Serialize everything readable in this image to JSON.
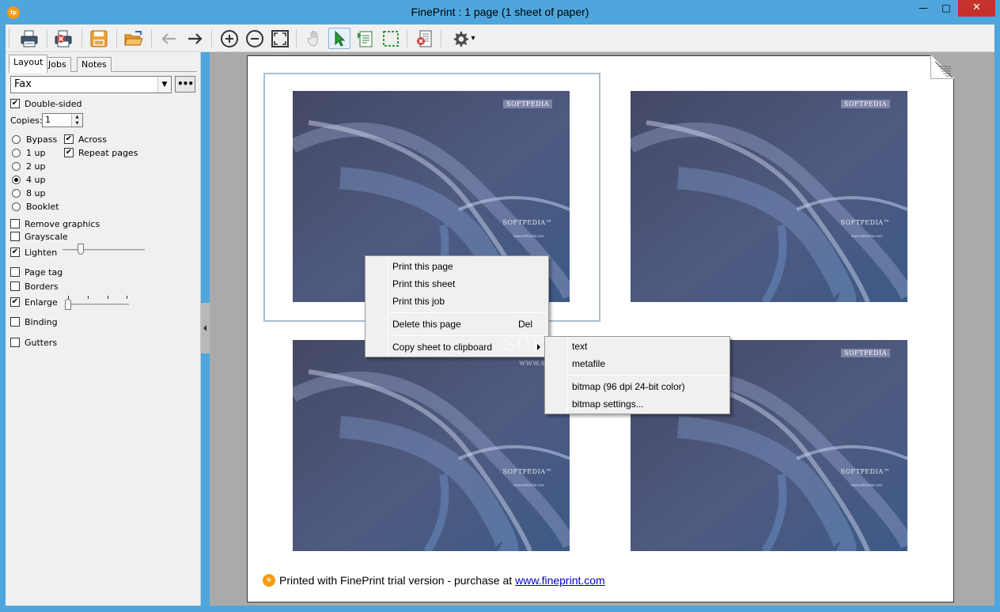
{
  "window": {
    "app_icon": "fp",
    "title": "FinePrint : 1 page (1 sheet of paper)",
    "minimize": "—",
    "maximize": "□",
    "close": "✕"
  },
  "toolbar": {
    "buttons": [
      {
        "name": "print-icon"
      },
      {
        "name": "discard-icon"
      },
      {
        "name": "save-icon"
      },
      {
        "name": "open-icon"
      },
      {
        "name": "back-arrow-icon"
      },
      {
        "name": "forward-arrow-icon"
      },
      {
        "name": "zoom-in-icon"
      },
      {
        "name": "zoom-out-icon"
      },
      {
        "name": "fit-icon"
      },
      {
        "name": "hand-icon"
      },
      {
        "name": "select-arrow-icon"
      },
      {
        "name": "edit-page-icon"
      },
      {
        "name": "marquee-icon"
      },
      {
        "name": "delete-page-icon"
      },
      {
        "name": "gear-icon"
      }
    ],
    "gear_dropdown": "▾"
  },
  "left_panel": {
    "tabs": [
      "Layout",
      "Jobs",
      "Notes"
    ],
    "printer": "Fax",
    "more_button": "•••",
    "double_sided": "Double-sided",
    "copies_label": "Copies:",
    "copies_value": "1",
    "layouts": [
      "Bypass",
      "1 up",
      "2 up",
      "4 up",
      "8 up",
      "Booklet"
    ],
    "selected_layout": "4 up",
    "across": "Across",
    "repeat_pages": "Repeat pages",
    "remove_graphics": "Remove graphics",
    "grayscale": "Grayscale",
    "lighten": "Lighten",
    "page_tag": "Page tag",
    "borders": "Borders",
    "enlarge": "Enlarge",
    "binding": "Binding",
    "gutters": "Gutters",
    "check": "✔"
  },
  "preview": {
    "brand": "SOFTPEDIA",
    "brand_tm": "SOFTPEDIA™",
    "url": "www.softpedia.com",
    "footer_text": "Printed with FinePrint trial version - purchase at",
    "footer_link": "www.fineprint.com",
    "footer_badge": "fp",
    "watermark_big": "SOFTPEDIA",
    "watermark_small": "www.softpedia.com"
  },
  "context_menu": {
    "items": [
      {
        "label": "Print this page"
      },
      {
        "label": "Print this sheet"
      },
      {
        "label": "Print this job"
      },
      {
        "label": "Delete this page",
        "shortcut": "Del"
      },
      {
        "label": "Copy sheet to clipboard"
      }
    ]
  },
  "submenu": {
    "items": [
      {
        "label": "text"
      },
      {
        "label": "metafile"
      },
      {
        "label": "bitmap (96 dpi 24-bit color)"
      },
      {
        "label": "bitmap settings..."
      }
    ]
  }
}
